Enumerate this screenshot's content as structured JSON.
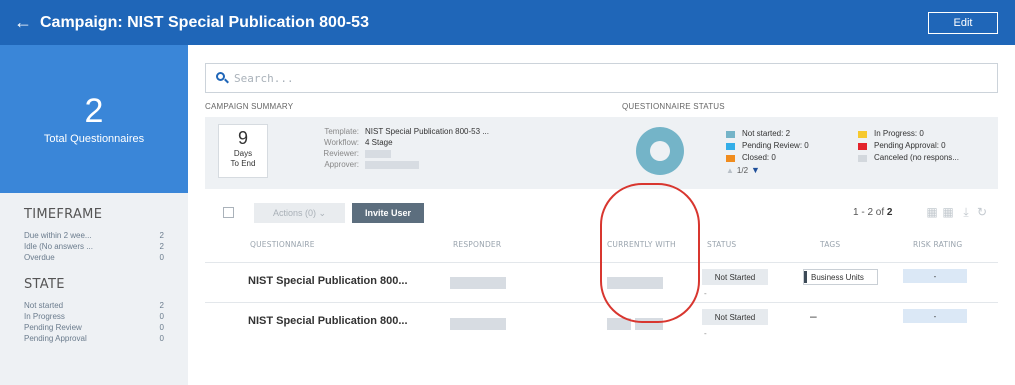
{
  "header": {
    "back_glyph": "←",
    "title": "Campaign: NIST Special Publication 800-53",
    "edit_label": "Edit"
  },
  "summary": {
    "total_count": "2",
    "total_label": "Total Questionnaires"
  },
  "sidebar": {
    "timeframe_heading": "TIMEFRAME",
    "timeframe_items": [
      {
        "label": "Due within 2 wee...",
        "count": "2"
      },
      {
        "label": "Idle (No answers ...",
        "count": "2"
      },
      {
        "label": "Overdue",
        "count": "0"
      }
    ],
    "state_heading": "STATE",
    "state_items": [
      {
        "label": "Not started",
        "count": "2"
      },
      {
        "label": "In Progress",
        "count": "0"
      },
      {
        "label": "Pending Review",
        "count": "0"
      },
      {
        "label": "Pending Approval",
        "count": "0"
      }
    ]
  },
  "search": {
    "placeholder": "Search..."
  },
  "campaign_summary": {
    "heading": "CAMPAIGN SUMMARY",
    "days_value": "9",
    "days_label_1": "Days",
    "days_label_2": "To End",
    "template_key": "Template:",
    "template_value": "NIST Special Publication 800-53 ...",
    "workflow_key": "Workflow:",
    "workflow_value": "4 Stage",
    "reviewer_key": "Reviewer:",
    "approver_key": "Approver:"
  },
  "questionnaire_status": {
    "heading": "QUESTIONNAIRE STATUS",
    "legend": [
      {
        "label": "Not started: 2",
        "color": "#74b4c8"
      },
      {
        "label": "Pending Review: 0",
        "color": "#33aee8"
      },
      {
        "label": "Closed: 0",
        "color": "#f08c1e"
      },
      {
        "label": "In Progress: 0",
        "color": "#f6c92e"
      },
      {
        "label": "Pending Approval: 0",
        "color": "#e3242b"
      },
      {
        "label": "Canceled (no respons...",
        "color": "#d3d8dd"
      }
    ],
    "pager": "1/2"
  },
  "toolbar": {
    "actions_label": "Actions (0)",
    "actions_chevron": "⌄",
    "invite_label": "Invite User",
    "count_prefix": "1 - 2 of",
    "count_total": "2"
  },
  "table": {
    "headers": [
      "QUESTIONNAIRE",
      "RESPONDER",
      "CURRENTLY WITH",
      "STATUS",
      "TAGS",
      "RISK RATING"
    ],
    "rows": [
      {
        "name": "NIST Special Publication 800...",
        "status": "Not Started",
        "status_sub": "-",
        "tag": "Business Units",
        "risk": "-"
      },
      {
        "name": "NIST Special Publication 800...",
        "status": "Not Started",
        "status_sub": "-",
        "tag_dash": "–",
        "risk": "-"
      }
    ]
  },
  "colors": {
    "header_blue": "#1f66b8",
    "tile_blue": "#3a86d8",
    "annotation_red": "#d8362f"
  }
}
